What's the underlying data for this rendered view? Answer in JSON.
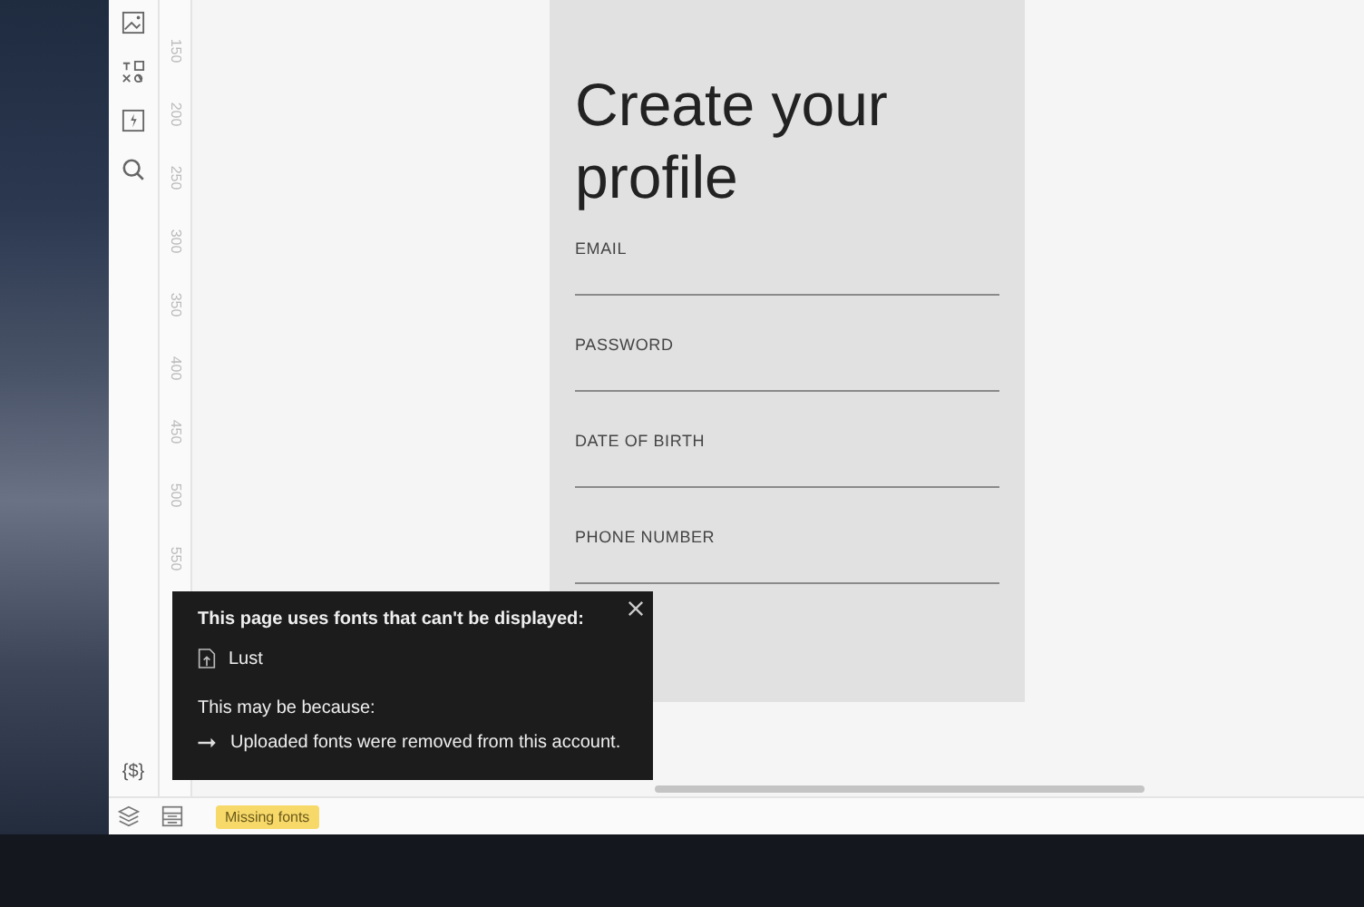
{
  "ruler": {
    "labels": [
      "150",
      "200",
      "250",
      "300",
      "350",
      "400",
      "450",
      "500",
      "550"
    ]
  },
  "toolbar": {
    "bottom_label": "{$}"
  },
  "artboard": {
    "title": "Create your profile",
    "fields": [
      {
        "label": "EMAIL"
      },
      {
        "label": "PASSWORD"
      },
      {
        "label": "DATE OF BIRTH"
      },
      {
        "label": "PHONE NUMBER"
      }
    ]
  },
  "popup": {
    "heading": "This page uses fonts that can't be displayed:",
    "fonts": [
      "Lust"
    ],
    "reason_heading": "This may be because:",
    "reasons": [
      "Uploaded fonts were removed from this account."
    ]
  },
  "status_bar": {
    "badge": "Missing fonts"
  }
}
